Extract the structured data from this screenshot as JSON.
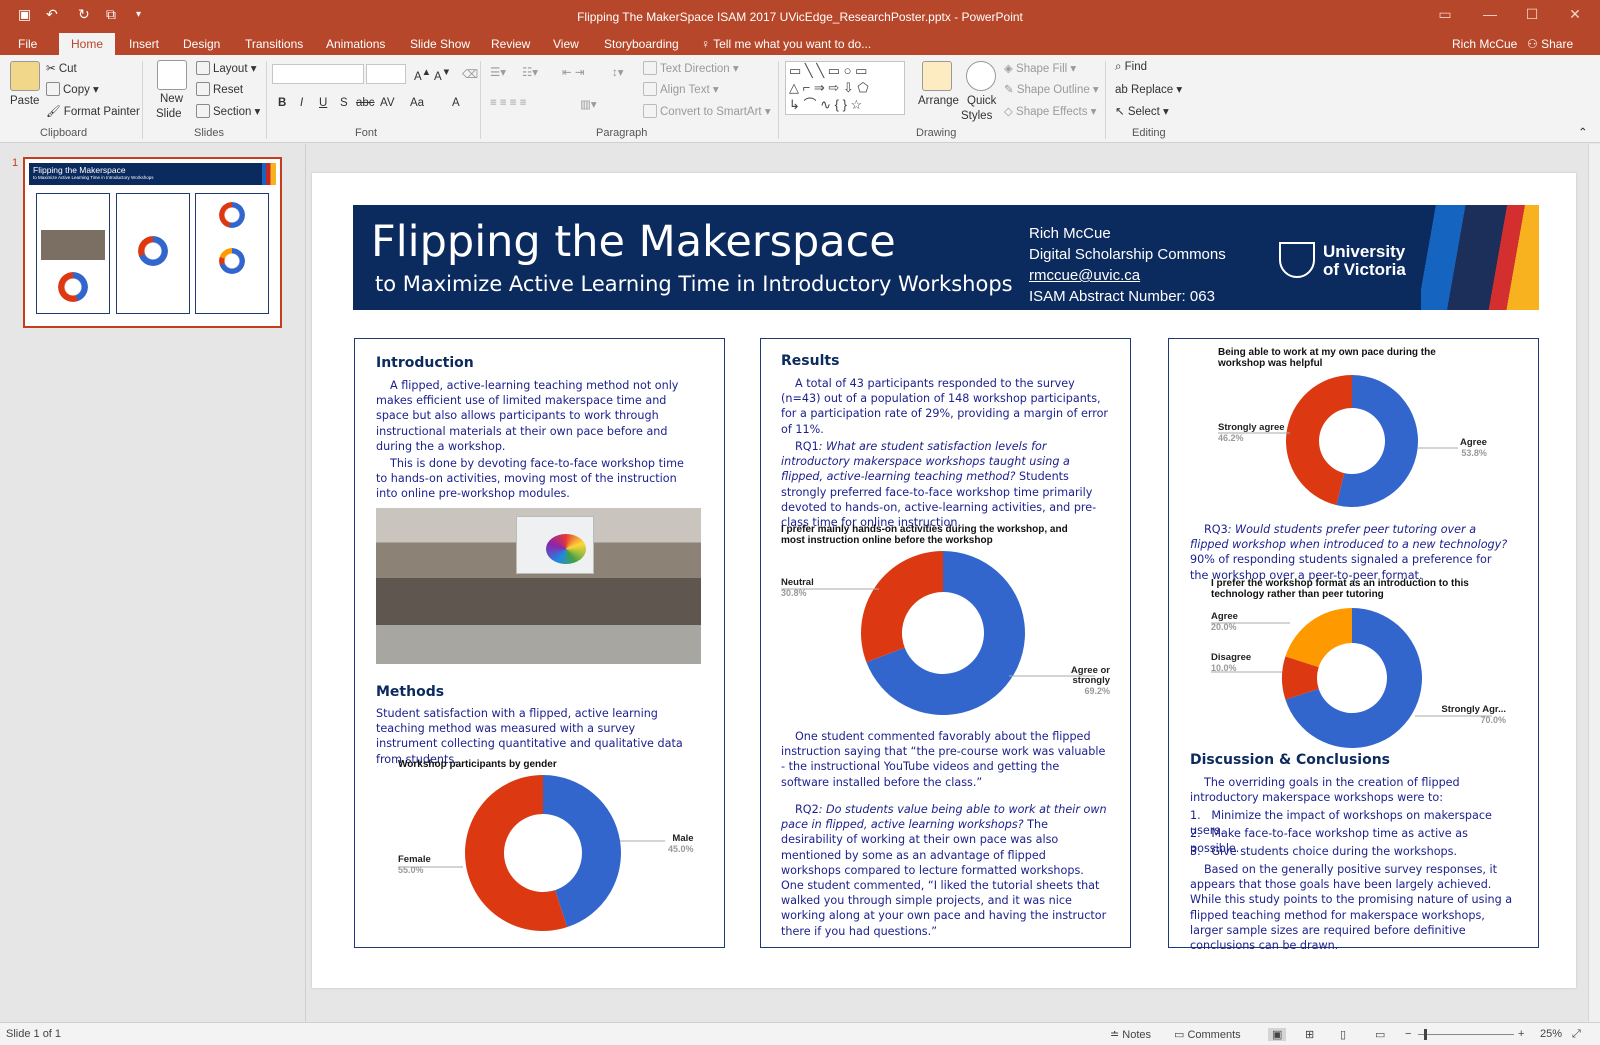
{
  "window": {
    "title": "Flipping The MakerSpace ISAM 2017 UVicEdge_ResearchPoster.pptx - PowerPoint",
    "user": "Rich McCue",
    "share": "Share"
  },
  "tabs": [
    "File",
    "Home",
    "Insert",
    "Design",
    "Transitions",
    "Animations",
    "Slide Show",
    "Review",
    "View",
    "Storyboarding"
  ],
  "tell_me": "Tell me what you want to do...",
  "ribbon": {
    "clipboard": {
      "paste": "Paste",
      "cut": "Cut",
      "copy": "Copy",
      "format_painter": "Format Painter",
      "label": "Clipboard"
    },
    "slides": {
      "new_slide": "New",
      "new_slide2": "Slide",
      "layout": "Layout",
      "reset": "Reset",
      "section": "Section",
      "label": "Slides"
    },
    "font": {
      "label": "Font",
      "bold": "B",
      "italic": "I",
      "underline": "U",
      "shadow": "S",
      "strike": "abc",
      "spacing": "AV",
      "case": "Aa",
      "color": "A"
    },
    "paragraph": {
      "text_direction": "Text Direction",
      "align_text": "Align Text",
      "convert": "Convert to SmartArt",
      "label": "Paragraph"
    },
    "drawing": {
      "arrange": "Arrange",
      "quick_styles": "Quick",
      "quick_styles2": "Styles",
      "shape_fill": "Shape Fill",
      "shape_outline": "Shape Outline",
      "shape_effects": "Shape Effects",
      "label": "Drawing"
    },
    "editing": {
      "find": "Find",
      "replace": "Replace",
      "select": "Select",
      "label": "Editing"
    }
  },
  "thumb": {
    "number": "1",
    "title": "Flipping the  Makerspace",
    "subtitle": "to Maximize Active Learning Time in Introductory Workshops"
  },
  "poster": {
    "title": "Flipping the Makerspace",
    "subtitle": "to Maximize Active Learning Time in Introductory Workshops",
    "author": "Rich McCue",
    "dept": "Digital Scholarship Commons",
    "email": "rmccue@uvic.ca",
    "abstract": "ISAM Abstract Number: 063",
    "university1": "University",
    "university2": "of Victoria",
    "intro": {
      "heading": "Introduction",
      "p1": "A flipped, active-learning teaching method not only makes efficient use of limited makerspace time and space but also allows participants to work through instructional materials at their own pace before and during the a workshop.",
      "p2": "This is done by devoting face-to-face workshop time to hands-on activities, moving most of the instruction into online pre-workshop modules."
    },
    "methods": {
      "heading": "Methods",
      "p": "Student satisfaction with a flipped, active learning teaching method was measured with a survey instrument collecting quantitative and qualitative data from students."
    },
    "results": {
      "heading": "Results",
      "p1": "A total of 43 participants responded to the survey (n=43) out of a population of 148 workshop participants, for a participation rate of 29%, providing a margin of error of 11%.",
      "rq1_label": "RQ1",
      "rq1_q": ": What are student satisfaction levels for introductory makerspace workshops taught using a flipped, active-learning teaching method?",
      "rq1_a": "Students strongly preferred face-to-face workshop time primarily devoted to hands-on, active-learning activities, and pre-class time for online instruction.",
      "p3": "One student commented favorably about the flipped instruction saying that “the pre-course work was valuable - the instructional YouTube videos and getting the software installed before the class.”",
      "rq2_label": "RQ2",
      "rq2_q": ": Do students value being able to work at their own pace in flipped, active learning workshops?",
      "rq2_a": "The desirability of working at their own pace was also mentioned by some as an advantage of flipped workshops compared to lecture formatted workshops. One student commented, “I liked the tutorial sheets that walked you through simple projects, and it was nice working along at your own pace and having the instructor there if you had questions.”"
    },
    "rq3": {
      "label": "RQ3",
      "q": ": Would students prefer peer tutoring over a flipped workshop when introduced to a new technology?",
      "a": "90% of responding students signaled a preference for the workshop over a peer-to-peer format."
    },
    "discussion": {
      "heading": "Discussion & Conclusions",
      "p1": "The overriding goals in the creation of flipped introductory makerspace workshops were to:",
      "items": [
        "Minimize the impact of workshops on makerspace users.",
        "Make face-to-face workshop time as active as possible.",
        "Give students choice during the workshops."
      ],
      "nums": [
        "1.",
        "2.",
        "3."
      ],
      "p2": "Based on the generally positive survey responses, it appears that those goals have been largely achieved. While this study points to the promising nature of using a flipped teaching method for makerspace workshops, larger sample sizes are required before definitive conclusions can be drawn."
    }
  },
  "chart_data": [
    {
      "type": "pie",
      "title": "Workshop participants by gender",
      "categories": [
        "Male",
        "Female"
      ],
      "values": [
        45.0,
        55.0
      ],
      "labels": [
        "45.0%",
        "55.0%"
      ],
      "colors": [
        "#3366cc",
        "#dc3912"
      ]
    },
    {
      "type": "pie",
      "title": "I prefer mainly hands-on activities during the workshop, and most instruction online before the workshop",
      "categories": [
        "Agree or strongly",
        "Neutral"
      ],
      "values": [
        69.2,
        30.8
      ],
      "labels": [
        "69.2%",
        "30.8%"
      ],
      "colors": [
        "#3366cc",
        "#dc3912"
      ]
    },
    {
      "type": "pie",
      "title": "Being able to work at my own pace during the workshop was helpful",
      "categories": [
        "Agree",
        "Strongly agree"
      ],
      "values": [
        53.8,
        46.2
      ],
      "labels": [
        "53.8%",
        "46.2%"
      ],
      "colors": [
        "#3366cc",
        "#dc3912"
      ]
    },
    {
      "type": "pie",
      "title": "I prefer the workshop format as an introduction to this technology rather than peer tutoring",
      "categories": [
        "Strongly Agr...",
        "Disagree",
        "Agree"
      ],
      "values": [
        70.0,
        10.0,
        20.0
      ],
      "labels": [
        "70.0%",
        "10.0%",
        "20.0%"
      ],
      "colors": [
        "#3366cc",
        "#dc3912",
        "#ff9900"
      ]
    }
  ],
  "status": {
    "slide": "Slide 1 of 1",
    "notes": "Notes",
    "comments": "Comments",
    "zoom": "25%"
  }
}
